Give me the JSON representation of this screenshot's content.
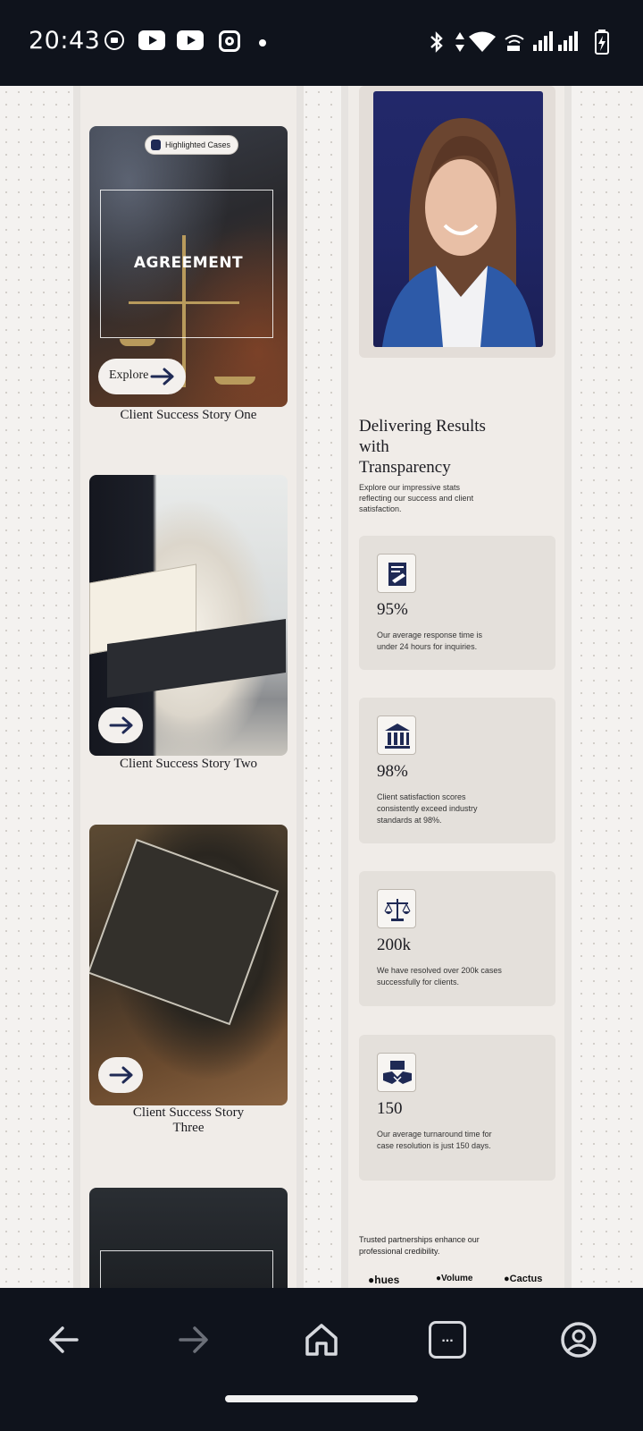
{
  "status_bar": {
    "time": "20:43",
    "icons": [
      "screen-record-icon",
      "youtube-icon",
      "youtube-icon",
      "instagram-icon",
      "dot-icon",
      "bluetooth-icon",
      "data-arrows-icon",
      "wifi-icon",
      "wifi-calling-icon",
      "signal-icon",
      "signal-icon",
      "battery-charging-icon"
    ]
  },
  "cases": [
    {
      "title": "Client Success Story One",
      "badge": "Highlighted Cases",
      "overlay": "AGREEMENT",
      "button": "Explore"
    },
    {
      "title": "Client Success Story Two"
    },
    {
      "title": "Client Success Story\nThree"
    }
  ],
  "results": {
    "title": "Delivering Results\nwith\nTransparency",
    "description": "Explore our impressive stats reflecting our success and client satisfaction."
  },
  "stats": [
    {
      "value": "95%",
      "description": "Our average response time is under 24 hours for inquiries.",
      "icon": "document-signature-icon"
    },
    {
      "value": "98%",
      "description": "Client satisfaction scores consistently exceed industry standards at 98%.",
      "icon": "courthouse-icon"
    },
    {
      "value": "200k",
      "description": "We have resolved over 200k cases successfully for clients.",
      "icon": "scales-icon"
    },
    {
      "value": "150",
      "description": "Our average turnaround time for case resolution is just 150 days.",
      "icon": "handshake-icon"
    }
  ],
  "partners": {
    "text": "Trusted partnerships enhance our professional credibility.",
    "logos": [
      "hues",
      "Volume",
      "Cactus"
    ]
  },
  "nav": {
    "buttons": [
      "back-icon",
      "forward-icon",
      "home-icon",
      "tabs-icon",
      "profile-icon"
    ],
    "tabs_label": "..."
  },
  "colors": {
    "accent": "#1f2a55",
    "card": "#e4e0db",
    "column": "#f0ece8"
  }
}
